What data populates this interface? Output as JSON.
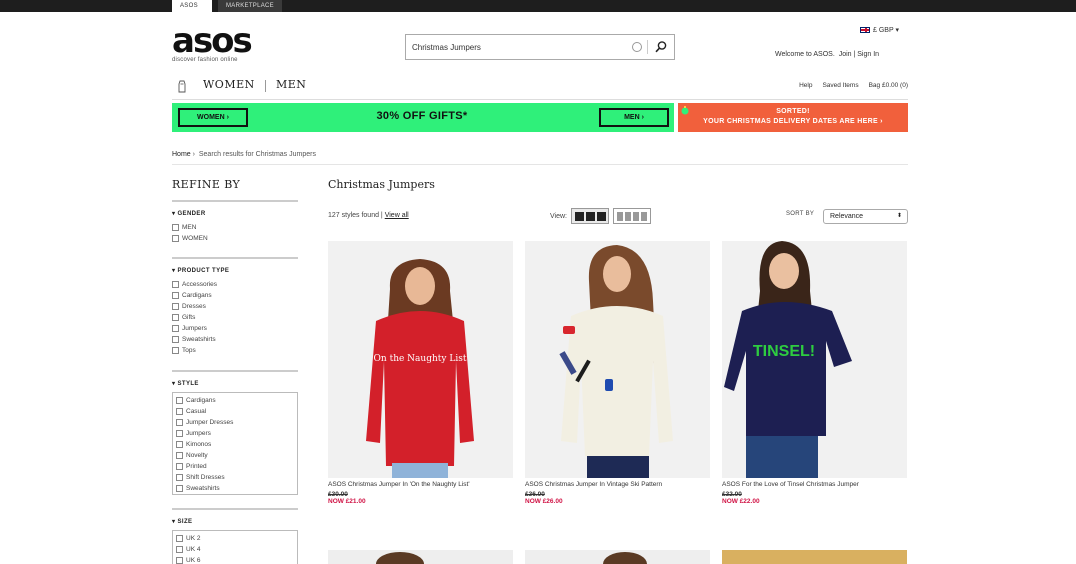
{
  "topbar": {
    "tabs": [
      "ASOS",
      "MARKETPLACE"
    ]
  },
  "header": {
    "logo": "asos",
    "tagline": "discover fashion online",
    "search_value": "Christmas Jumpers",
    "currency": "£ GBP ▾",
    "welcome": "Welcome to ASOS.",
    "join": "Join",
    "sign_in": "Sign In"
  },
  "nav": {
    "women": "WOMEN",
    "men": "MEN",
    "help": "Help",
    "saved_items": "Saved Items",
    "bag": "Bag",
    "bag_total": "£0.00 (0)"
  },
  "promo": {
    "women_btn": "WOMEN ›",
    "headline": "30% OFF GIFTS*",
    "men_btn": "MEN ›",
    "red_line1": "SORTED!",
    "red_line2": "YOUR CHRISTMAS DELIVERY DATES ARE HERE ›"
  },
  "breadcrumb": {
    "home": "Home",
    "sep": "›",
    "current": "Search results for Christmas Jumpers"
  },
  "sidebar": {
    "title": "REFINE BY",
    "gender": {
      "title": "▾ GENDER",
      "options": [
        "MEN",
        "WOMEN"
      ]
    },
    "product_type": {
      "title": "▾ PRODUCT TYPE",
      "options": [
        "Accessories",
        "Cardigans",
        "Dresses",
        "Gifts",
        "Jumpers",
        "Sweatshirts",
        "Tops"
      ]
    },
    "style": {
      "title": "▾ STYLE",
      "options": [
        "Cardigans",
        "Casual",
        "Jumper Dresses",
        "Jumpers",
        "Kimonos",
        "Novelty",
        "Printed",
        "Shift Dresses",
        "Sweatshirts"
      ]
    },
    "size": {
      "title": "▾ SIZE",
      "options": [
        "UK 2",
        "UK 4",
        "UK 6"
      ]
    }
  },
  "results": {
    "title": "Christmas Jumpers",
    "count_text": "127 styles found",
    "view_all": "View all",
    "view_label": "View:",
    "sort_label": "SORT BY",
    "sort_value": "Relevance"
  },
  "products": [
    {
      "name": "ASOS Christmas Jumper In 'On the Naughty List'",
      "was": "£30.00",
      "now": "NOW £21.00",
      "sweater_color": "#d3202a",
      "print": "On the Naughty List"
    },
    {
      "name": "ASOS Christmas Jumper In Vintage Ski Pattern",
      "was": "£36.00",
      "now": "NOW £26.00",
      "sweater_color": "#f2efe2",
      "print": ""
    },
    {
      "name": "ASOS For the Love of Tinsel Christmas Jumper",
      "was": "£32.00",
      "now": "NOW £22.00",
      "sweater_color": "#1d1f52",
      "print": "TINSEL!"
    }
  ],
  "colors": {
    "promo_green": "#2ff07a",
    "promo_red": "#f1603c",
    "price_red": "#d01345"
  }
}
